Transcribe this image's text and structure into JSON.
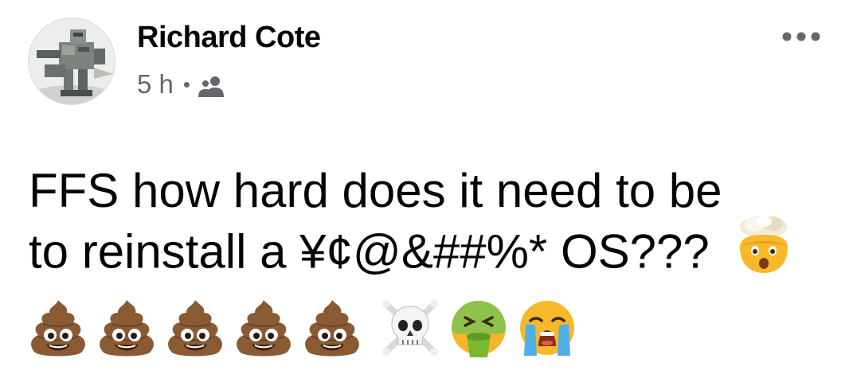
{
  "post": {
    "author_name": "Richard Cote",
    "timestamp": "5 h",
    "separator": "•",
    "audience_icon": "friends-icon",
    "more_icon": "more-dots-icon",
    "text_line_1": "FFS how hard does it need to be",
    "text_line_2": "to reinstall a ¥¢@&##%* OS???",
    "inline_emoji": "exploding-head-emoji",
    "emoji_row": [
      "pile-of-poo-emoji",
      "pile-of-poo-emoji",
      "pile-of-poo-emoji",
      "pile-of-poo-emoji",
      "pile-of-poo-emoji",
      "skull-and-crossbones-emoji",
      "nauseated-face-emoji",
      "crying-face-emoji"
    ]
  },
  "colors": {
    "text_primary": "#050505",
    "text_secondary": "#65676b",
    "background": "#ffffff"
  }
}
